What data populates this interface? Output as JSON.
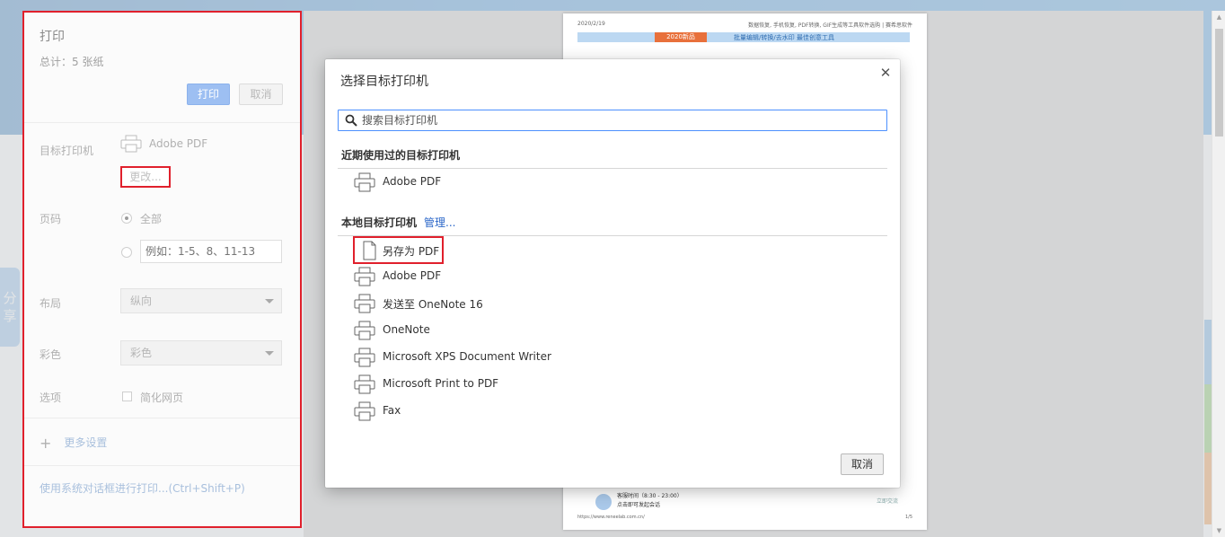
{
  "sidebar": {
    "title": "打印",
    "total": "总计：5 张纸",
    "print_button": "打印",
    "cancel_button": "取消",
    "destination_label": "目标打印机",
    "destination_value": "Adobe PDF",
    "change_button": "更改...",
    "pages_label": "页码",
    "pages_all": "全部",
    "pages_custom_placeholder": "例如：1-5、8、11-13",
    "layout_label": "布局",
    "layout_value": "纵向",
    "color_label": "彩色",
    "color_value": "彩色",
    "options_label": "选项",
    "options_simplify": "简化网页",
    "more_settings": "更多设置",
    "system_dialog": "使用系统对话框进行打印...(Ctrl+Shift+P)"
  },
  "share": {
    "line1": "分",
    "line2": "享"
  },
  "dialog": {
    "title": "选择目标打印机",
    "search_placeholder": "搜索目标打印机",
    "recent_header": "近期使用过的目标打印机",
    "recent_items": [
      "Adobe PDF"
    ],
    "local_header": "本地目标打印机",
    "manage_link": "管理...",
    "local_items": [
      "另存为 PDF",
      "Adobe PDF",
      "发送至 OneNote 16",
      "OneNote",
      "Microsoft XPS Document Writer",
      "Microsoft Print to PDF",
      "Fax"
    ],
    "cancel_button": "取消"
  },
  "preview": {
    "header_left": "2020/2/19",
    "header_right": "数据恢复, 手机恢复, PDF转换, GIF生成等工具软件选购 | 赛希思软件",
    "bar_badge": "2020新品",
    "bar_text": "批量编辑/转换/去水印 最佳创意工具",
    "footer_service": "客服时间（8:30 - 23:00）",
    "footer_chat": "点击即可发起会话",
    "footer_right": "立即交流",
    "footer_url": "https://www.reneelab.com.cn/",
    "footer_page": "1/5"
  },
  "colors": {
    "accent_red": "#e0202c",
    "link_blue": "#2a66c8",
    "focus_blue": "#4d90fe"
  }
}
